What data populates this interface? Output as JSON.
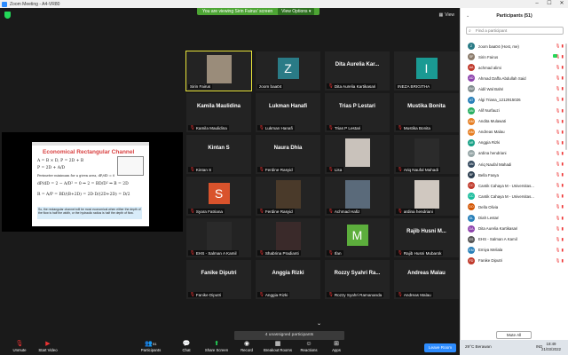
{
  "window": {
    "title": "Zoom Meeting - A4-VR80",
    "minimize": "–",
    "maximize": "☐",
    "close": "✕"
  },
  "banner": {
    "text": "You are viewing Sirin Fairus' screen",
    "view_options": "View Options ▾"
  },
  "view_label": "View",
  "slide": {
    "title": "Economical Rectangular Channel",
    "eq1": "A = B × D,   P = 2D + B",
    "eq2": "P = 2D + A/D",
    "eq3": "Perimeter minimum for a given area,  dP/dD = 0",
    "eq4": "dP/dD = 2 − A/D² = 0 ⇒ 2 = BD/D² ⇒ B = 2D",
    "eq5": "R = A/P = BD/(B+2D) = 2D·D/(2D+2D) = D/2",
    "note": "So, the rectangular channel will be most economical when either the depth of the flow is half the width, or the hydraulic radius is half the depth of flow."
  },
  "tiles": [
    {
      "name": "Sirin Fairus",
      "big": "",
      "avatar": "",
      "type": "photo",
      "muted": false,
      "active": true,
      "color": "#9a8c7a"
    },
    {
      "name": "zoom baa04",
      "big": "",
      "avatar": "Z",
      "type": "avatar",
      "muted": false,
      "active": false,
      "color": "#2a7b86"
    },
    {
      "name": "Dita Aurelia Kartikasari",
      "big": "Dita Aurelia Kar...",
      "avatar": "",
      "type": "name",
      "muted": true,
      "active": false,
      "color": ""
    },
    {
      "name": "INEZA BRIGITHA",
      "big": "",
      "avatar": "I",
      "type": "avatar",
      "muted": false,
      "active": false,
      "color": "#1a9a93"
    },
    {
      "name": "Kamila Maulidina",
      "big": "Kamila Maulidina",
      "avatar": "",
      "type": "name",
      "muted": true,
      "active": false,
      "color": ""
    },
    {
      "name": "Lukman Hanafi",
      "big": "Lukman Hanafi",
      "avatar": "",
      "type": "name",
      "muted": true,
      "active": false,
      "color": ""
    },
    {
      "name": "Trias P Lestari",
      "big": "Trias P Lestari",
      "avatar": "",
      "type": "name",
      "muted": true,
      "active": false,
      "color": ""
    },
    {
      "name": "Mustika Bonita",
      "big": "Mustika Bonita",
      "avatar": "",
      "type": "name",
      "muted": true,
      "active": false,
      "color": ""
    },
    {
      "name": "Kintan S",
      "big": "Kintan S",
      "avatar": "",
      "type": "name",
      "muted": true,
      "active": false,
      "color": ""
    },
    {
      "name": "Ferdine Rasyid",
      "big": "Naura Dhia",
      "avatar": "",
      "type": "name",
      "muted": true,
      "active": false,
      "color": ""
    },
    {
      "name": "Lisa",
      "big": "",
      "avatar": "",
      "type": "photo",
      "muted": true,
      "active": false,
      "color": "#c9c2bb"
    },
    {
      "name": "Ariq Naufal Mahadi",
      "big": "",
      "avatar": "",
      "type": "photo",
      "muted": true,
      "active": false,
      "color": "#2b2b2b"
    },
    {
      "name": "Syara Fatriana",
      "big": "",
      "avatar": "S",
      "type": "avatar",
      "muted": true,
      "active": false,
      "color": "#d9532c"
    },
    {
      "name": "Ferdine Rasyid",
      "big": "",
      "avatar": "",
      "type": "photo",
      "muted": true,
      "active": false,
      "color": "#4a3a2a"
    },
    {
      "name": "Achmad Hafiz",
      "big": "",
      "avatar": "",
      "type": "photo",
      "muted": true,
      "active": false,
      "color": "#5a6a7a"
    },
    {
      "name": "ardina hendriani",
      "big": "",
      "avatar": "",
      "type": "photo",
      "muted": true,
      "active": false,
      "color": "#d0c8c0"
    },
    {
      "name": "EHS - Salman A Kamil",
      "big": "",
      "avatar": "",
      "type": "photo",
      "muted": true,
      "active": false,
      "color": "#2a2a2a"
    },
    {
      "name": "Shabrina Pradianti",
      "big": "",
      "avatar": "",
      "type": "photo",
      "muted": true,
      "active": false,
      "color": "#3a2a2a"
    },
    {
      "name": "Ifan",
      "big": "",
      "avatar": "M",
      "type": "avatar",
      "muted": true,
      "active": false,
      "color": "#5cae3c"
    },
    {
      "name": "Rajib Husni Mubarok",
      "big": "Rajib Husni M...",
      "avatar": "",
      "type": "name",
      "muted": true,
      "active": false,
      "color": ""
    },
    {
      "name": "Fanike Diputri",
      "big": "Fanike Diputri",
      "avatar": "",
      "type": "name",
      "muted": true,
      "active": false,
      "color": ""
    },
    {
      "name": "Anggia Rizki",
      "big": "Anggia Rizki",
      "avatar": "",
      "type": "name",
      "muted": true,
      "active": false,
      "color": ""
    },
    {
      "name": "Rozzy Syahri Ramananda",
      "big": "Rozzy Syahri Ra...",
      "avatar": "",
      "type": "name",
      "muted": true,
      "active": false,
      "color": ""
    },
    {
      "name": "Andreas Malau",
      "big": "Andreas Malau",
      "avatar": "",
      "type": "name",
      "muted": true,
      "active": false,
      "color": ""
    }
  ],
  "unassigned": "4 unassigned participants",
  "panel": {
    "title": "Participants (51)",
    "search_placeholder": "Find a participant",
    "mute_all": "Mute All",
    "participants": [
      {
        "name": "zoom baa04 (Host, me)",
        "initials": "Z",
        "color": "#2a7b86",
        "video": false
      },
      {
        "name": "Sirin Fairus",
        "initials": "SF",
        "color": "#8a7a6a",
        "video": true
      },
      {
        "name": "achmad alimi",
        "initials": "AA",
        "color": "#c0392b",
        "video": false
      },
      {
        "name": "Ahmad Daffa Abdullah Said",
        "initials": "AD",
        "color": "#8e44ad",
        "video": false
      },
      {
        "name": "Aidil Wal Bahri",
        "initials": "AW",
        "color": "#7f8c8d",
        "video": false
      },
      {
        "name": "Algi Triana_1212915026",
        "initials": "AT",
        "color": "#2980b9",
        "video": false
      },
      {
        "name": "Alif Nurfauzi",
        "initials": "AN",
        "color": "#27ae60",
        "video": false
      },
      {
        "name": "Andita Mulawati",
        "initials": "AM",
        "color": "#e67e22",
        "video": false
      },
      {
        "name": "Andreas Malau",
        "initials": "AM",
        "color": "#e67e22",
        "video": false
      },
      {
        "name": "Anggia Rizki",
        "initials": "AR",
        "color": "#16a085",
        "video": false
      },
      {
        "name": "ardina hendriani",
        "initials": "AH",
        "color": "#95a5a6",
        "video": false
      },
      {
        "name": "Ariq Naufal Mahadi",
        "initials": "AN",
        "color": "#34495e",
        "video": false
      },
      {
        "name": "Bella Fasya",
        "initials": "BF",
        "color": "#2c3e50",
        "video": false
      },
      {
        "name": "Cantik Cahaya M - Universitas...",
        "initials": "CC",
        "color": "#c0392b",
        "video": false
      },
      {
        "name": "Cantik Cahaya M - Universitas...",
        "initials": "CC",
        "color": "#1abc9c",
        "video": false
      },
      {
        "name": "Della Olivia",
        "initials": "DO",
        "color": "#d35400",
        "video": false
      },
      {
        "name": "Diah Lestari",
        "initials": "DL",
        "color": "#2980b9",
        "video": false
      },
      {
        "name": "Dita Aurelia Kartikasari",
        "initials": "DA",
        "color": "#8e44ad",
        "video": false
      },
      {
        "name": "EHS - Salman A Kamil",
        "initials": "ES",
        "color": "#555555",
        "video": false
      },
      {
        "name": "Emiya Meliala",
        "initials": "EM",
        "color": "#2980b9",
        "video": false
      },
      {
        "name": "Fanike Diputri",
        "initials": "FD",
        "color": "#c0392b",
        "video": false
      }
    ]
  },
  "toolbar": {
    "unmute": "Unmute",
    "start_video": "Start Video",
    "participants": "Participants",
    "participants_count": "51",
    "chat": "Chat",
    "share_screen": "Share Screen",
    "record": "Record",
    "breakout": "Breakout Rooms",
    "reactions": "Reactions",
    "apps": "Apps",
    "leave": "Leave Room"
  },
  "taskbar": {
    "weather": "29°C  Berawan",
    "lang": "IND",
    "time": "18:49",
    "date": "21/03/2022"
  },
  "colors": {
    "share_green": "#23d959",
    "banner_green": "#4da534",
    "leave_red": "#2d8cff"
  }
}
